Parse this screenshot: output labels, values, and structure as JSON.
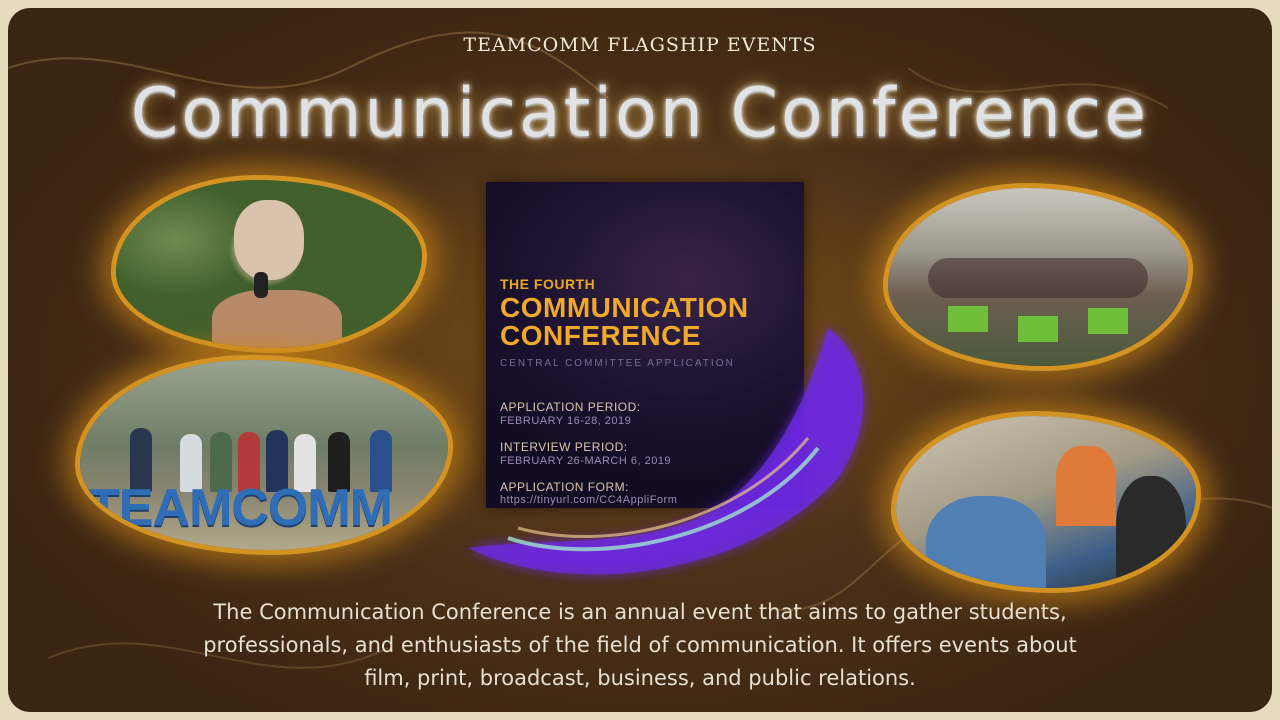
{
  "header": {
    "subtitle": "TEAMCOMM FLAGSHIP EVENTS",
    "title": "Communication Conference"
  },
  "photos": {
    "team_sign": "TEAMCOMM"
  },
  "poster": {
    "kicker": "THE FOURTH",
    "title_line1": "COMMUNICATION",
    "title_line2": "CONFERENCE",
    "subtitle": "CENTRAL COMMITTEE APPLICATION",
    "application_period_label": "APPLICATION PERIOD:",
    "application_period_value": "FEBRUARY 16-28, 2019",
    "interview_period_label": "INTERVIEW PERIOD:",
    "interview_period_value": "FEBRUARY 26-MARCH 6, 2019",
    "application_form_label": "APPLICATION FORM:",
    "application_form_value": "https://tinyurl.com/CC4AppliForm"
  },
  "description": "The Communication Conference is an annual event that aims to gather students, professionals, and enthusiasts of the field of communication. It offers events about film, print, broadcast, business, and public relations.",
  "colors": {
    "background": "#4a3018",
    "glow": "#d79623",
    "poster_accent": "#f0a92a",
    "ribbon": "#7a3cff"
  }
}
